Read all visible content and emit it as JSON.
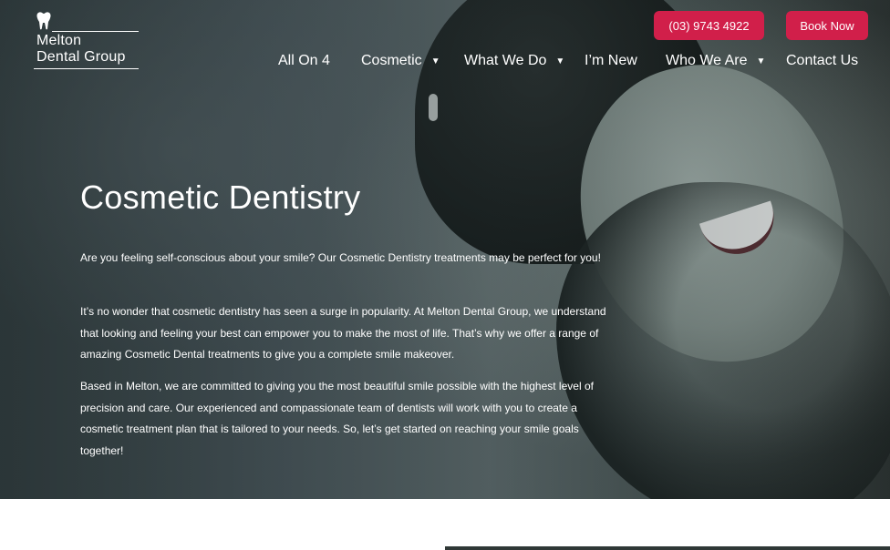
{
  "brand": {
    "line1": "Melton",
    "line2": "Dental Group"
  },
  "header": {
    "phone_label": "(03) 9743 4922",
    "book_label": "Book Now",
    "accent_color": "#d11f4a"
  },
  "nav": {
    "items": [
      {
        "label": "All On 4",
        "dropdown": false
      },
      {
        "label": "Cosmetic",
        "dropdown": true
      },
      {
        "label": "What We Do",
        "dropdown": true
      },
      {
        "label": "I’m New",
        "dropdown": false
      },
      {
        "label": "Who We Are",
        "dropdown": true
      },
      {
        "label": "Contact Us",
        "dropdown": false
      }
    ],
    "caret": "▼"
  },
  "hero": {
    "title": "Cosmetic Dentistry",
    "paragraphs": [
      "Are you feeling self-conscious about your smile? Our Cosmetic Dentistry treatments may be perfect for you!",
      "It’s no wonder that cosmetic dentistry has seen a surge in popularity. At Melton Dental Group, we understand that looking and feeling your best can empower you to make the most of life. That’s why we offer a range of amazing Cosmetic Dental treatments to give you a complete smile makeover.",
      "Based in Melton, we are committed to giving you the most beautiful smile possible with the highest level of precision and care. Our experienced and compassionate team of dentists will work with you to create a cosmetic treatment plan that is tailored to your needs. So, let’s get started on reaching your smile goals together!"
    ]
  }
}
